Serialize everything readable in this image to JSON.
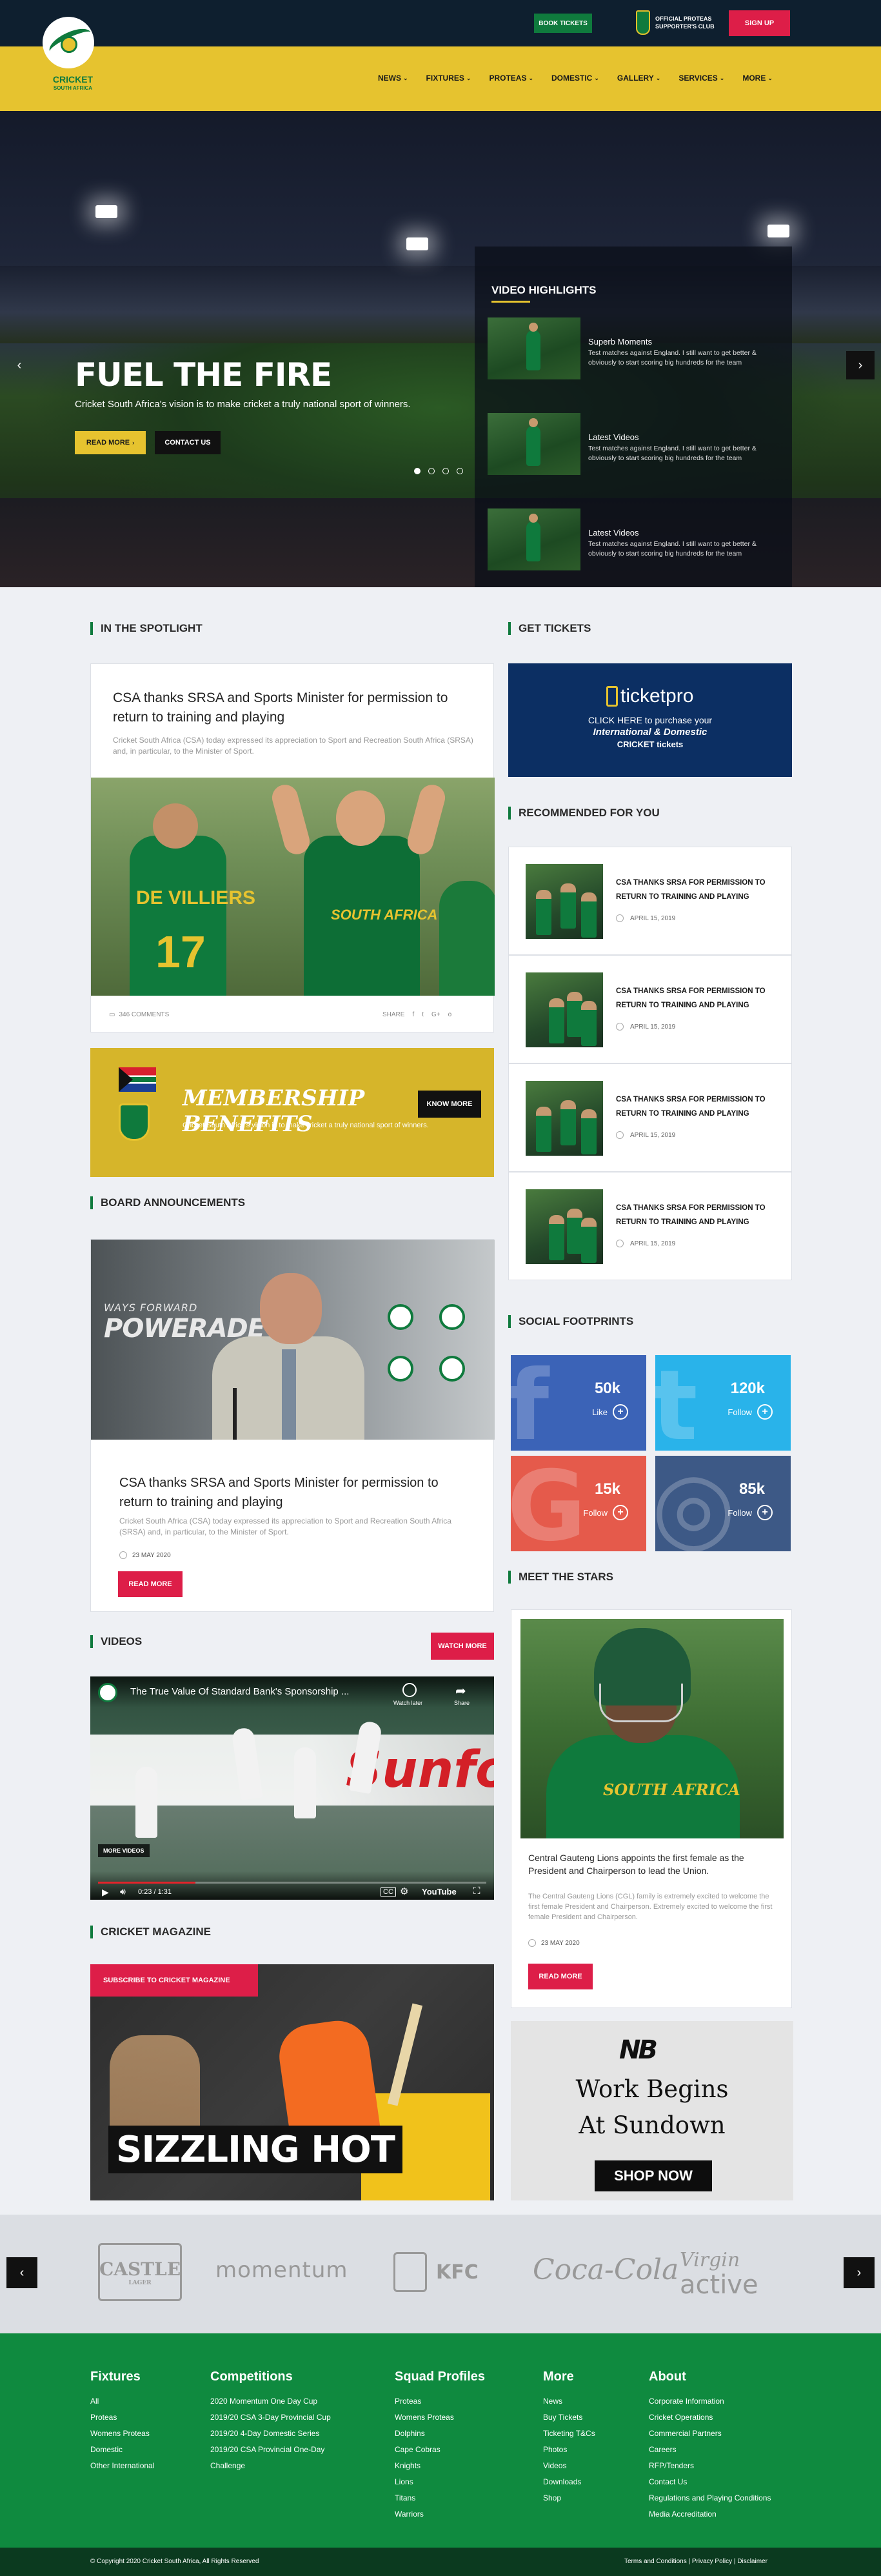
{
  "header": {
    "book_tickets": "BOOK TICKETS",
    "club_line1": "OFFICIAL PROTEAS",
    "club_line2": "SUPPORTER'S CLUB",
    "sign_up": "SIGN UP",
    "logo_name": "CRICKET",
    "logo_sub": "SOUTH AFRICA",
    "nav": [
      {
        "label": "NEWS"
      },
      {
        "label": "FIXTURES"
      },
      {
        "label": "PROTEAS"
      },
      {
        "label": "DOMESTIC"
      },
      {
        "label": "GALLERY"
      },
      {
        "label": "SERVICES"
      },
      {
        "label": "MORE"
      }
    ]
  },
  "hero": {
    "title": "FUEL THE FIRE",
    "subtitle": "Cricket South Africa's vision is to make cricket a truly national sport of winners.",
    "read_more": "READ MORE",
    "contact_us": "CONTACT US",
    "slide_count": 4,
    "active_slide": 1,
    "video_highlights_title": "VIDEO HIGHLIGHTS",
    "videos": [
      {
        "name": "Superb Moments",
        "desc": "Test matches against England. I still want to get better & obviously to start scoring big hundreds for the team"
      },
      {
        "name": "Latest Videos",
        "desc": "Test matches against England. I still want to get better & obviously to start scoring big hundreds for the team"
      },
      {
        "name": "Latest Videos",
        "desc": "Test matches against England. I still want to get better & obviously to start scoring big hundreds for the team"
      }
    ]
  },
  "spotlight": {
    "heading": "IN THE SPOTLIGHT",
    "title": "CSA thanks SRSA and Sports Minister for permission to return to training and playing",
    "text": "Cricket South Africa (CSA) today expressed its appreciation to Sport and Recreation South Africa (SRSA) and, in particular, to the Minister of Sport.",
    "player_names": [
      "DE VILLIERS",
      "17",
      "SOUTH AFRICA"
    ],
    "comments": "346 COMMENTS",
    "share": "SHARE",
    "share_icons": [
      "f",
      "t",
      "G+",
      "o"
    ]
  },
  "membership": {
    "title": "MEMBERSHIP BENEFITS",
    "subtitle": "Cricket South Africa's vision is to make cricket a truly national sport of winners.",
    "button": "KNOW MORE"
  },
  "board": {
    "heading": "BOARD ANNOUNCEMENTS",
    "banner_small": "WAYS FORWARD",
    "banner_big": "POWERADE",
    "title": "CSA thanks SRSA and Sports Minister for permission to return to training and playing",
    "text": "Cricket South Africa (CSA) today expressed its appreciation to Sport and Recreation South Africa (SRSA) and, in particular, to the Minister of Sport.",
    "date": "23 MAY 2020",
    "read_more": "READ MORE"
  },
  "videos": {
    "heading": "VIDEOS",
    "watch_more": "WATCH MORE",
    "video_title": "The True Value Of Standard Bank's Sponsorship ...",
    "watch_later": "Watch later",
    "share": "Share",
    "more_videos": "MORE VIDEOS",
    "time": "0:23 / 1:31",
    "progress": 0.25,
    "brand": "Sunfoil",
    "youtube": "YouTube"
  },
  "magazine": {
    "heading": "CRICKET MAGAZINE",
    "subscribe": "SUBSCRIBE TO CRICKET MAGAZINE",
    "cover_text": "SIZZLING HOT"
  },
  "tickets": {
    "heading": "GET TICKETS",
    "brand": "ticketpro",
    "line1": "CLICK HERE to purchase your",
    "line2": "International & Domestic",
    "line3": "CRICKET tickets"
  },
  "recommended": {
    "heading": "RECOMMENDED FOR YOU",
    "items": [
      {
        "title": "CSA THANKS SRSA FOR PERMISSION TO RETURN TO TRAINING AND PLAYING",
        "date": "APRIL 15, 2019"
      },
      {
        "title": "CSA THANKS SRSA FOR PERMISSION TO RETURN TO TRAINING AND PLAYING",
        "date": "APRIL 15, 2019"
      },
      {
        "title": "CSA THANKS SRSA FOR PERMISSION TO RETURN TO TRAINING AND PLAYING",
        "date": "APRIL 15, 2019"
      },
      {
        "title": "CSA THANKS SRSA FOR PERMISSION TO RETURN TO TRAINING AND PLAYING",
        "date": "APRIL 15, 2019"
      }
    ]
  },
  "social": {
    "heading": "SOCIAL FOOTPRINTS",
    "items": [
      {
        "network": "facebook",
        "count": "50k",
        "action": "Like",
        "color": "#3b63b7",
        "glyph": "f"
      },
      {
        "network": "twitter",
        "count": "120k",
        "action": "Follow",
        "color": "#29b3ea",
        "glyph": "t"
      },
      {
        "network": "google-plus",
        "count": "15k",
        "action": "Follow",
        "color": "#e55a4b",
        "glyph": "G"
      },
      {
        "network": "instagram",
        "count": "85k",
        "action": "Follow",
        "color": "#3d5986",
        "glyph": "◎"
      }
    ]
  },
  "stars": {
    "heading": "MEET THE STARS",
    "shirt_text": "SOUTH AFRICA",
    "title": "Central Gauteng Lions appoints the first female as the President and Chairperson to lead the Union.",
    "text": "The Central Gauteng Lions (CGL) family is extremely excited to welcome the first female President and Chairperson. Extremely excited to welcome the first female President and Chairperson.",
    "date": "23 MAY 2020",
    "read_more": "READ MORE"
  },
  "ad": {
    "brand": "NB",
    "line1": "Work Begins",
    "line2": "At Sundown",
    "button": "SHOP NOW"
  },
  "sponsors": {
    "castle": "CASTLE",
    "castle_sub": "LAGER",
    "momentum": "momentum",
    "kfc": "KFC",
    "cocacola": "Coca-Cola",
    "virgin_1": "Virgin",
    "virgin_2": "active"
  },
  "footer": {
    "columns": [
      {
        "heading": "Fixtures",
        "links": [
          "All",
          "Proteas",
          "Womens Proteas",
          "Domestic",
          "Other International"
        ]
      },
      {
        "heading": "Competitions",
        "links": [
          "2020 Momentum One Day Cup",
          "2019/20 CSA 3-Day Provincial Cup",
          "2019/20 4-Day Domestic Series",
          "2019/20 CSA Provincial One-Day",
          "Challenge"
        ]
      },
      {
        "heading": "Squad Profiles",
        "links": [
          "Proteas",
          "Womens Proteas",
          "Dolphins",
          "Cape Cobras",
          "Knights",
          "Lions",
          "Titans",
          "Warriors"
        ]
      },
      {
        "heading": "More",
        "links": [
          "News",
          "Buy Tickets",
          "Ticketing T&Cs",
          "Photos",
          "Videos",
          "Downloads",
          "Shop"
        ]
      },
      {
        "heading": "About",
        "links": [
          "Corporate Information",
          "Cricket Operations",
          "Commercial Partners",
          "Careers",
          "RFP/Tenders",
          "Contact Us",
          "Regulations and Playing Conditions",
          "Media Accreditation"
        ]
      }
    ],
    "copyright": "© Copyright 2020 Cricket South Africa, All Rights Reserved",
    "legal": "Terms and Conditions | Privacy Policy | Disclaimer"
  }
}
